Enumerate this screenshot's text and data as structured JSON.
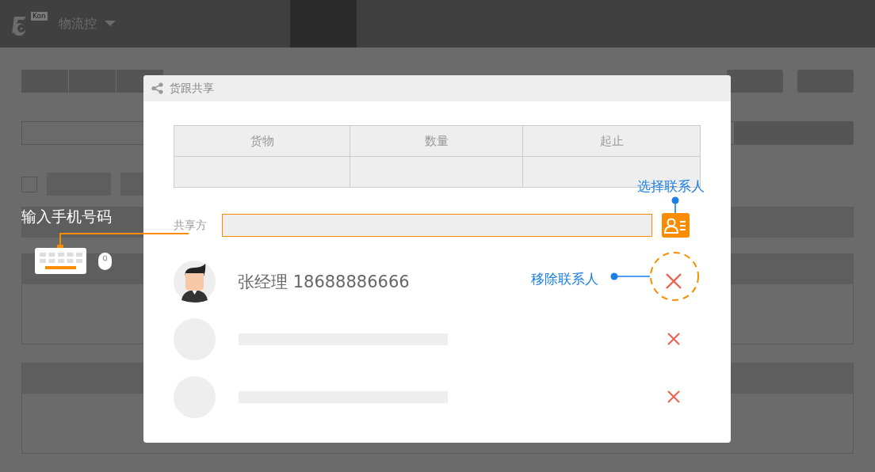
{
  "header": {
    "logo_badge": "Kon",
    "app_name": "物流控"
  },
  "list": {
    "select_all": {
      "checked": false
    }
  },
  "dialog": {
    "title": "货跟共享",
    "table": {
      "columns": [
        "货物",
        "数量",
        "起止"
      ]
    },
    "share_label": "共享方",
    "contacts": [
      {
        "kind": "contact",
        "text": "张经理 18688886666"
      },
      {
        "kind": "empty"
      },
      {
        "kind": "empty"
      }
    ]
  },
  "annotations": {
    "input": "输入手机号码",
    "select": "选择联系人",
    "remove": "移除联系人"
  }
}
